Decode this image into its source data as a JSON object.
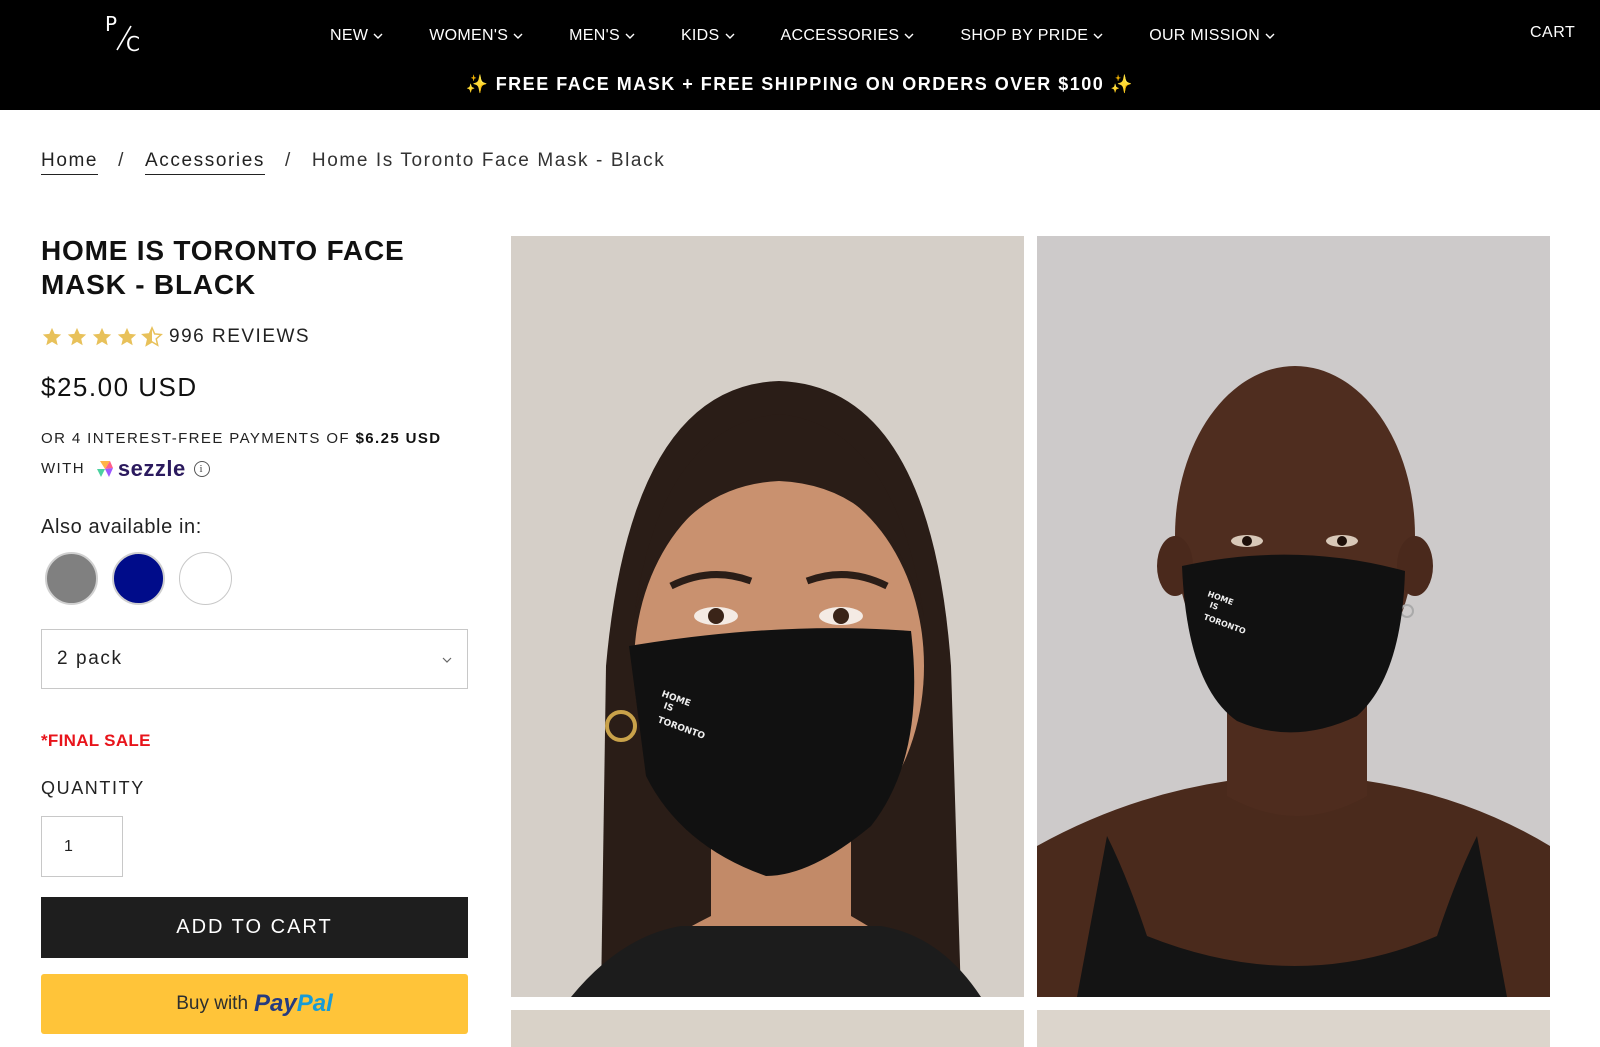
{
  "header": {
    "logo_letters": {
      "top": "P",
      "bottom": "C"
    },
    "nav": [
      {
        "label": "NEW"
      },
      {
        "label": "WOMEN'S"
      },
      {
        "label": "MEN'S"
      },
      {
        "label": "KIDS"
      },
      {
        "label": "ACCESSORIES"
      },
      {
        "label": "SHOP BY PRIDE"
      },
      {
        "label": "OUR MISSION"
      }
    ],
    "cart_label": "CART",
    "promo": "FREE FACE MASK + FREE SHIPPING ON ORDERS OVER $100",
    "promo_sparkle": "✨"
  },
  "breadcrumb": {
    "home": "Home",
    "category": "Accessories",
    "current": "Home Is Toronto Face Mask - Black",
    "separator": "/"
  },
  "product": {
    "title": "HOME IS TORONTO FACE MASK - BLACK",
    "rating_stars": 4.5,
    "reviews": "996 REVIEWS",
    "price": "$25.00 USD",
    "installments_prefix": "OR 4 INTEREST-FREE PAYMENTS OF",
    "installment_amount": "$6.25 USD",
    "installments_with": "WITH",
    "sezzle_word": "sezzle",
    "info_symbol": "i",
    "also_available": "Also available in:",
    "swatches": [
      {
        "name": "grey",
        "color": "#808080"
      },
      {
        "name": "navy",
        "color": "#000c8a"
      },
      {
        "name": "white",
        "color": "#ffffff"
      }
    ],
    "pack_option": "2 pack",
    "final_sale": "*FINAL SALE",
    "quantity_label": "QUANTITY",
    "quantity_value": "1",
    "add_to_cart": "ADD TO CART",
    "paypal_buy": "Buy with",
    "paypal_pay": "Pay",
    "paypal_pal": "Pal"
  },
  "colors": {
    "header_bg": "#000000",
    "star": "#e8c15a",
    "final_sale": "#e8141b",
    "add_to_cart_bg": "#1e1e1e",
    "paypal_bg": "#ffc439",
    "paypal_dark": "#253b80",
    "paypal_light": "#179bd7",
    "mask_print": "HOME IS TORONTO"
  }
}
